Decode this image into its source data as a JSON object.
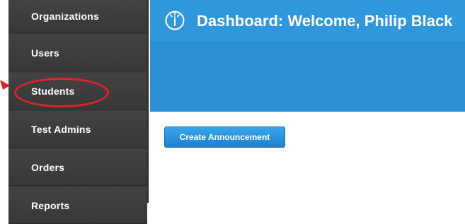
{
  "sidebar": {
    "items": [
      {
        "label": "Organizations"
      },
      {
        "label": "Users"
      },
      {
        "label": "Students"
      },
      {
        "label": "Test Admins"
      },
      {
        "label": "Orders"
      },
      {
        "label": "Reports"
      }
    ],
    "highlighted_item": "Students"
  },
  "header": {
    "title": "Dashboard: Welcome, Philip Black",
    "icon": "info-circle-icon"
  },
  "main": {
    "create_announcement_label": "Create Announcement"
  },
  "colors": {
    "sidebar_bg": "#3b3b3b",
    "header_bg": "#2a8fd5",
    "button_bg": "#2b93e0",
    "highlight": "#e0242b"
  }
}
